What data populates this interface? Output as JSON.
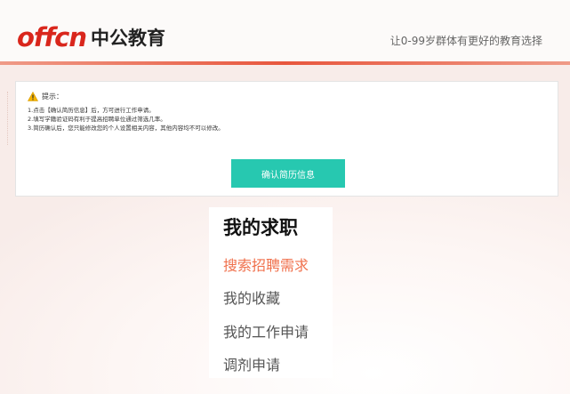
{
  "header": {
    "logo_en": "offcn",
    "logo_cn": "中公教育",
    "slogan": "让0-99岁群体有更好的教育选择"
  },
  "notice": {
    "tip_label": "提示：",
    "tips": [
      "1.点击【确认简历信息】后，方可进行工作申请。",
      "2.填写学籍验证码有利于提高招聘单位通过筛选几率。",
      "3.简历确认后，您只能修改您的个人设置相关内容，其他内容均不可以修改。"
    ],
    "confirm_label": "确认简历信息"
  },
  "menu": {
    "title": "我的求职",
    "items": [
      {
        "label": "搜索招聘需求",
        "active": true
      },
      {
        "label": "我的收藏",
        "active": false
      },
      {
        "label": "我的工作申请",
        "active": false
      },
      {
        "label": "调剂申请",
        "active": false
      }
    ]
  },
  "colors": {
    "brand_red": "#d9261c",
    "button_teal": "#27c8b0",
    "active_orange": "#f0714d"
  }
}
